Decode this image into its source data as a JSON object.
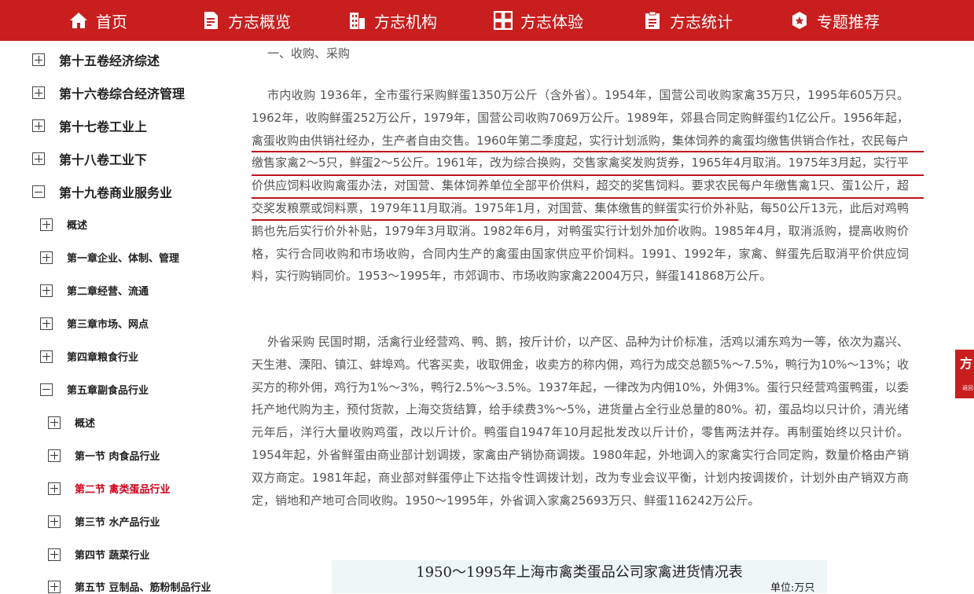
{
  "nav": [
    {
      "icon": "home-icon",
      "label": "首页"
    },
    {
      "icon": "document-icon",
      "label": "方志概览"
    },
    {
      "icon": "building-icon",
      "label": "方志机构"
    },
    {
      "icon": "grid-icon",
      "label": "方志体验"
    },
    {
      "icon": "clipboard-icon",
      "label": "方志统计"
    },
    {
      "icon": "badge-icon",
      "label": "专题推荐"
    }
  ],
  "sidebar": {
    "volumes": [
      {
        "label": "第十五卷经济综述",
        "state": "plus"
      },
      {
        "label": "第十六卷综合经济管理",
        "state": "plus"
      },
      {
        "label": "第十七卷工业上",
        "state": "plus"
      },
      {
        "label": "第十八卷工业下",
        "state": "plus"
      },
      {
        "label": "第十九卷商业服务业",
        "state": "minus"
      }
    ],
    "chapters": [
      {
        "label": "概述",
        "state": "plus"
      },
      {
        "label": "第一章企业、体制、管理",
        "state": "plus"
      },
      {
        "label": "第二章经营、流通",
        "state": "plus"
      },
      {
        "label": "第三章市场、网点",
        "state": "plus"
      },
      {
        "label": "第四章粮食行业",
        "state": "plus"
      },
      {
        "label": "第五章副食品行业",
        "state": "minus"
      }
    ],
    "sections": [
      {
        "label": "概述",
        "state": "plus"
      },
      {
        "label": "第一节 肉食品行业",
        "state": "plus"
      },
      {
        "label": "第二节 禽类蛋品行业",
        "state": "plus",
        "active": true
      },
      {
        "label": "第三节 水产品行业",
        "state": "plus"
      },
      {
        "label": "第四节 蔬菜行业",
        "state": "plus"
      },
      {
        "label": "第五节 豆制品、筋粉制品行业",
        "state": "plus"
      }
    ]
  },
  "content": {
    "section_title": "一、收购、采购",
    "para1": "市内收购 1936年，全市蛋行采购鲜蛋1350万公斤（含外省）。1954年，国营公司收购家禽35万只，1995年605万只。1962年，收购鲜蛋252万公斤，1979年，国营公司收购7069万公斤。1989年，郊县合同定购鲜蛋约1亿公斤。1956年起，禽蛋收购由供销社经办，生产者自由交售。1960年第二季度起，实行计划派购，集体饲养的禽蛋均缴售供销合作社，农民每户缴售家禽2～5只，鲜蛋2～5公斤。1961年，改为综合换购，交售家禽奖发购货券，1965年4月取消。1975年3月起，实行平价供应饲料收购禽蛋办法，对国营、集体饲养单位全部平价供料，超交的奖售饲料。要求农民每户年缴售禽1只、蛋1公斤，超交奖发粮票或饲料票，1979年11月取消。1975年1月，对国营、集体缴售的鲜蛋实行价外补贴，每50公斤13元，此后对鸡鸭鹅也先后实行价外补贴，1979年3月取消。1982年6月，对鸭蛋实行计划外加价收购。1985年4月，取消派购，提高收购价格，实行合同收购和市场收购，合同内生产的禽蛋由国家供应平价饲料。1991、1992年，家禽、鲜蛋先后取消平价供应饲料，实行购销同价。1953～1995年，市郊调市、市场收购家禽22004万只，鲜蛋141868万公斤。",
    "para2": "外省采购 民国时期，活禽行业经营鸡、鸭、鹅，按斤计价，以产区、品种为计价标准，活鸡以浦东鸡为一等，依次为嘉兴、天生港、溧阳、镇江、蚌埠鸡。代客买卖，收取佣金，收卖方的称内佣，鸡行为成交总额5%～7.5%，鸭行为10%～13%；收买方的称外佣，鸡行为1%～3%，鸭行2.5%～3.5%。1937年起，一律改为内佣10%，外佣3%。蛋行只经营鸡蛋鸭蛋，以委托产地代购为主，预付货款，上海交货结算，给手续费3%～5%，进货量占全行业总量的80%。初，蛋品均以只计价，清光绪元年后，洋行大量收购鸡蛋，改以斤计价。鸭蛋自1947年10月起批发改以斤计价，零售两法并存。再制蛋始终以只计价。1954年起，外省鲜蛋由商业部计划调拨，家禽由产销协商调拨。1980年起，外地调入的家禽实行合同定购，数量价格由产销双方商定。1981年起，商业部对鲜蛋停止下达指令性调拨计划，改为专业会议平衡，计划内按调拨价，计划外由产销双方商定，销地和产地可合同收购。1950～1995年，外省调入家禽25693万只、鲜蛋116242万公斤。",
    "table_caption": "1950～1995年上海市禽类蛋品公司家禽进货情况表",
    "table_unit": "单位:万只"
  },
  "side_tab": {
    "big": "方",
    "small": "返回"
  }
}
